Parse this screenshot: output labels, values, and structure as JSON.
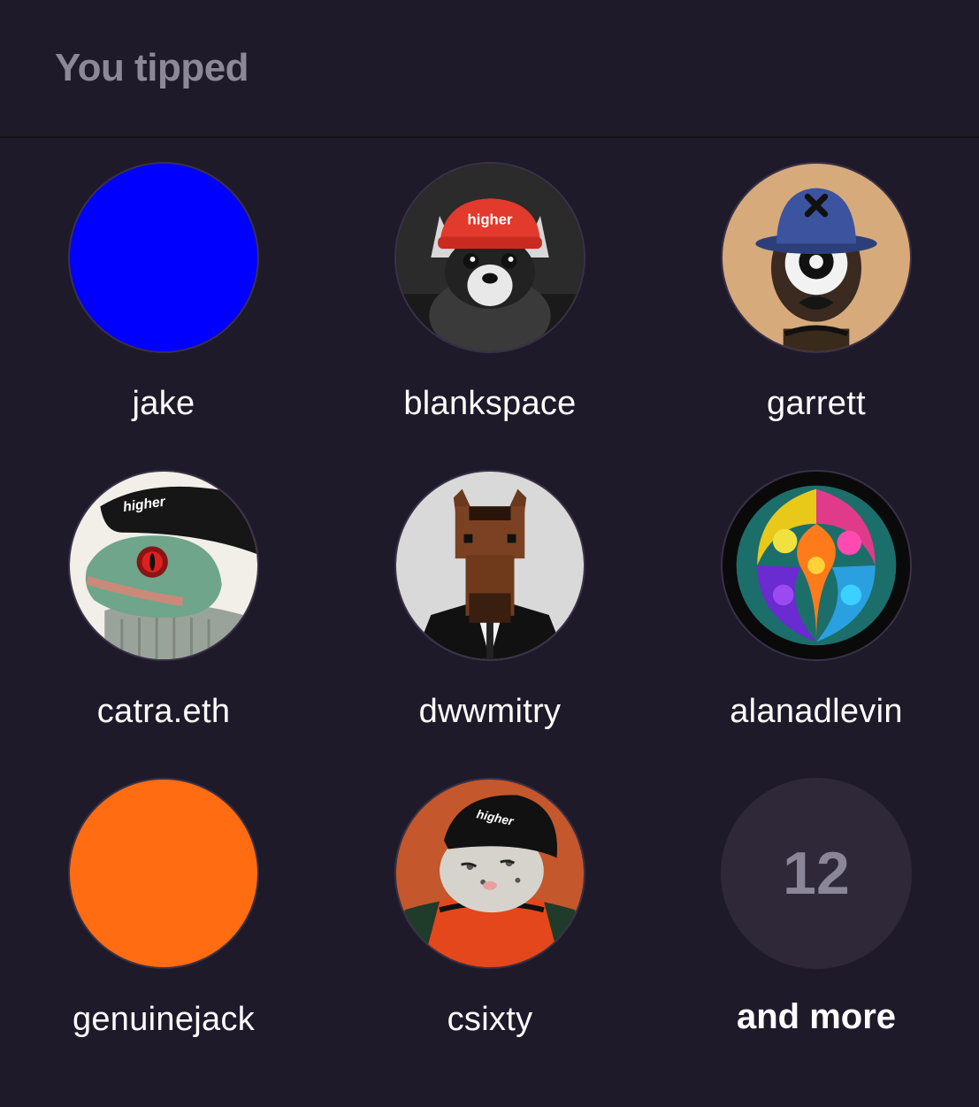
{
  "header": {
    "title": "You tipped"
  },
  "users": [
    {
      "name": "jake",
      "avatar_icon": "solid-blue-circle",
      "color": "#0000ff"
    },
    {
      "name": "blankspace",
      "avatar_icon": "chihuahua-red-higher-hat"
    },
    {
      "name": "garrett",
      "avatar_icon": "cyclops-bucket-hat"
    },
    {
      "name": "catra.eth",
      "avatar_icon": "lizard-higher-beanie"
    },
    {
      "name": "dwwmitry",
      "avatar_icon": "horse-in-suit"
    },
    {
      "name": "alanadlevin",
      "avatar_icon": "psychedelic-swirl"
    },
    {
      "name": "genuinejack",
      "avatar_icon": "solid-orange-circle",
      "color": "#ff6c11"
    },
    {
      "name": "csixty",
      "avatar_icon": "snow-leopard-higher-beanie"
    }
  ],
  "more": {
    "count": "12",
    "label": "and more"
  }
}
